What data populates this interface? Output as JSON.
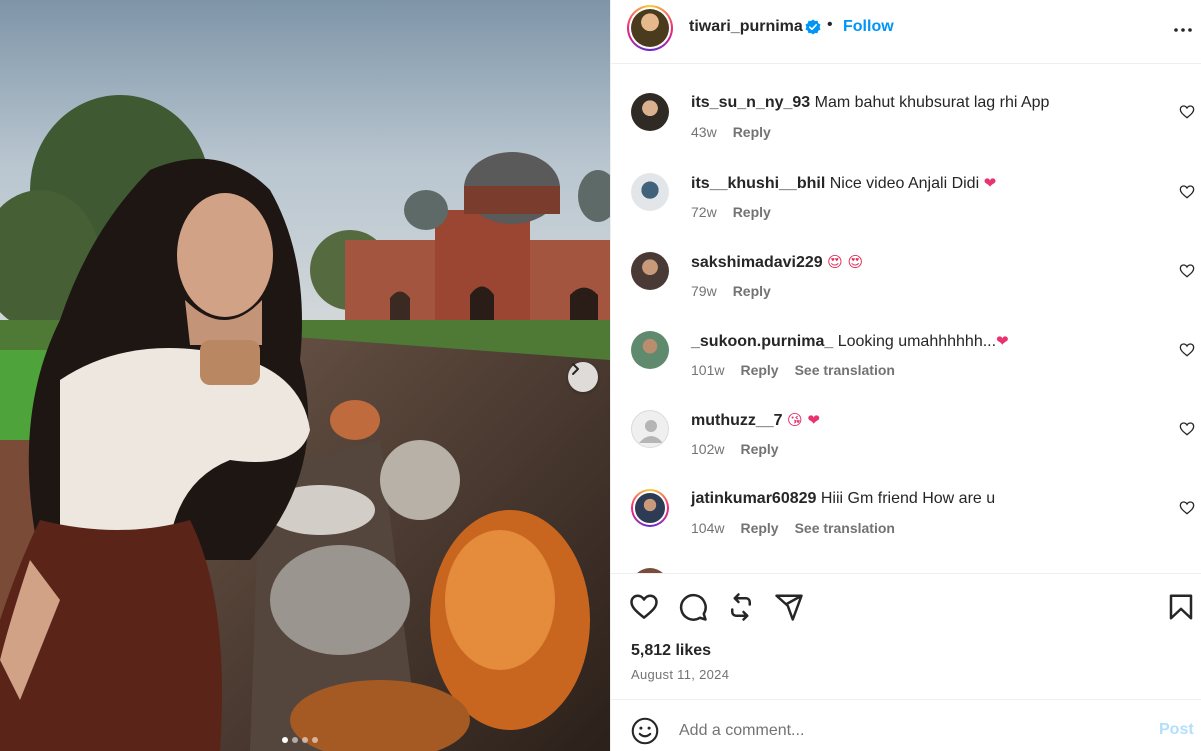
{
  "post": {
    "username": "tiwari_purnima",
    "separator": "•",
    "follow_label": "Follow",
    "likes": "5,812 likes",
    "date": "August 11, 2024",
    "carousel_total": 4,
    "carousel_active": 1
  },
  "comments": [
    {
      "user": "its_su_n_ny_93",
      "text": "Mam bahut khubsurat lag rhi App",
      "emoji": "",
      "age": "43w",
      "reply": "Reply",
      "translate": ""
    },
    {
      "user": "its__khushi__bhil",
      "text": "Nice video Anjali Didi",
      "emoji": "❤",
      "age": "72w",
      "reply": "Reply",
      "translate": ""
    },
    {
      "user": "sakshimadavi229",
      "text": "",
      "emoji": "😍 😍",
      "age": "79w",
      "reply": "Reply",
      "translate": ""
    },
    {
      "user": "_sukoon.purnima_",
      "text": "Looking umahhhhhh...",
      "emoji": "❤",
      "age": "101w",
      "reply": "Reply",
      "translate": "See translation"
    },
    {
      "user": "muthuzz__7",
      "text": "",
      "emoji": "😘 ❤",
      "age": "102w",
      "reply": "Reply",
      "translate": ""
    },
    {
      "user": "jatinkumar60829",
      "text": "Hiii Gm friend How are u",
      "emoji": "",
      "age": "104w",
      "reply": "Reply",
      "translate": "See translation"
    }
  ],
  "composer": {
    "placeholder": "Add a comment...",
    "post_label": "Post"
  },
  "icons": {
    "verified": "verified-badge-icon",
    "more": "more-options-icon",
    "like": "heart-icon",
    "comment": "comment-icon",
    "repost": "repost-icon",
    "share": "share-icon",
    "save": "bookmark-icon",
    "emoji": "emoji-icon",
    "next": "chevron-right-icon"
  },
  "colors": {
    "accent": "#0095f6",
    "post_disabled": "#b2dffc",
    "muted": "#737373",
    "heart_emoji": "#e8336e"
  }
}
